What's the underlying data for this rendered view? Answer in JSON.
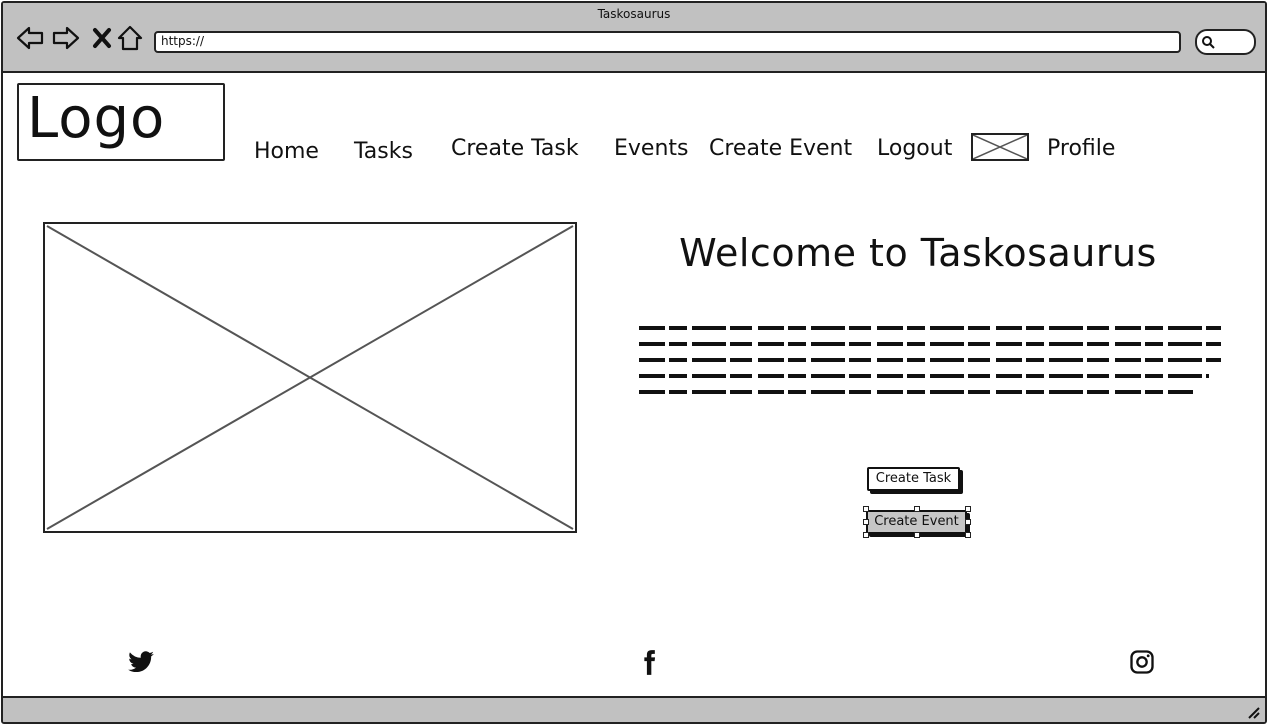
{
  "window": {
    "title": "Taskosaurus",
    "address": "https://"
  },
  "header": {
    "logo_text": "Logo",
    "nav": {
      "home": "Home",
      "tasks": "Tasks",
      "create_task": "Create Task",
      "events": "Events",
      "create_event": "Create Event",
      "logout": "Logout",
      "profile": "Profile"
    }
  },
  "main": {
    "heading": "Welcome to Taskosaurus",
    "buttons": {
      "create_task": "Create Task",
      "create_event": "Create Event"
    }
  },
  "footer": {
    "icons": [
      "twitter-icon",
      "facebook-icon",
      "instagram-icon"
    ]
  },
  "colors": {
    "chrome": "#c1c1c1",
    "selected_button": "#c6c6c6",
    "stroke": "#222222"
  }
}
